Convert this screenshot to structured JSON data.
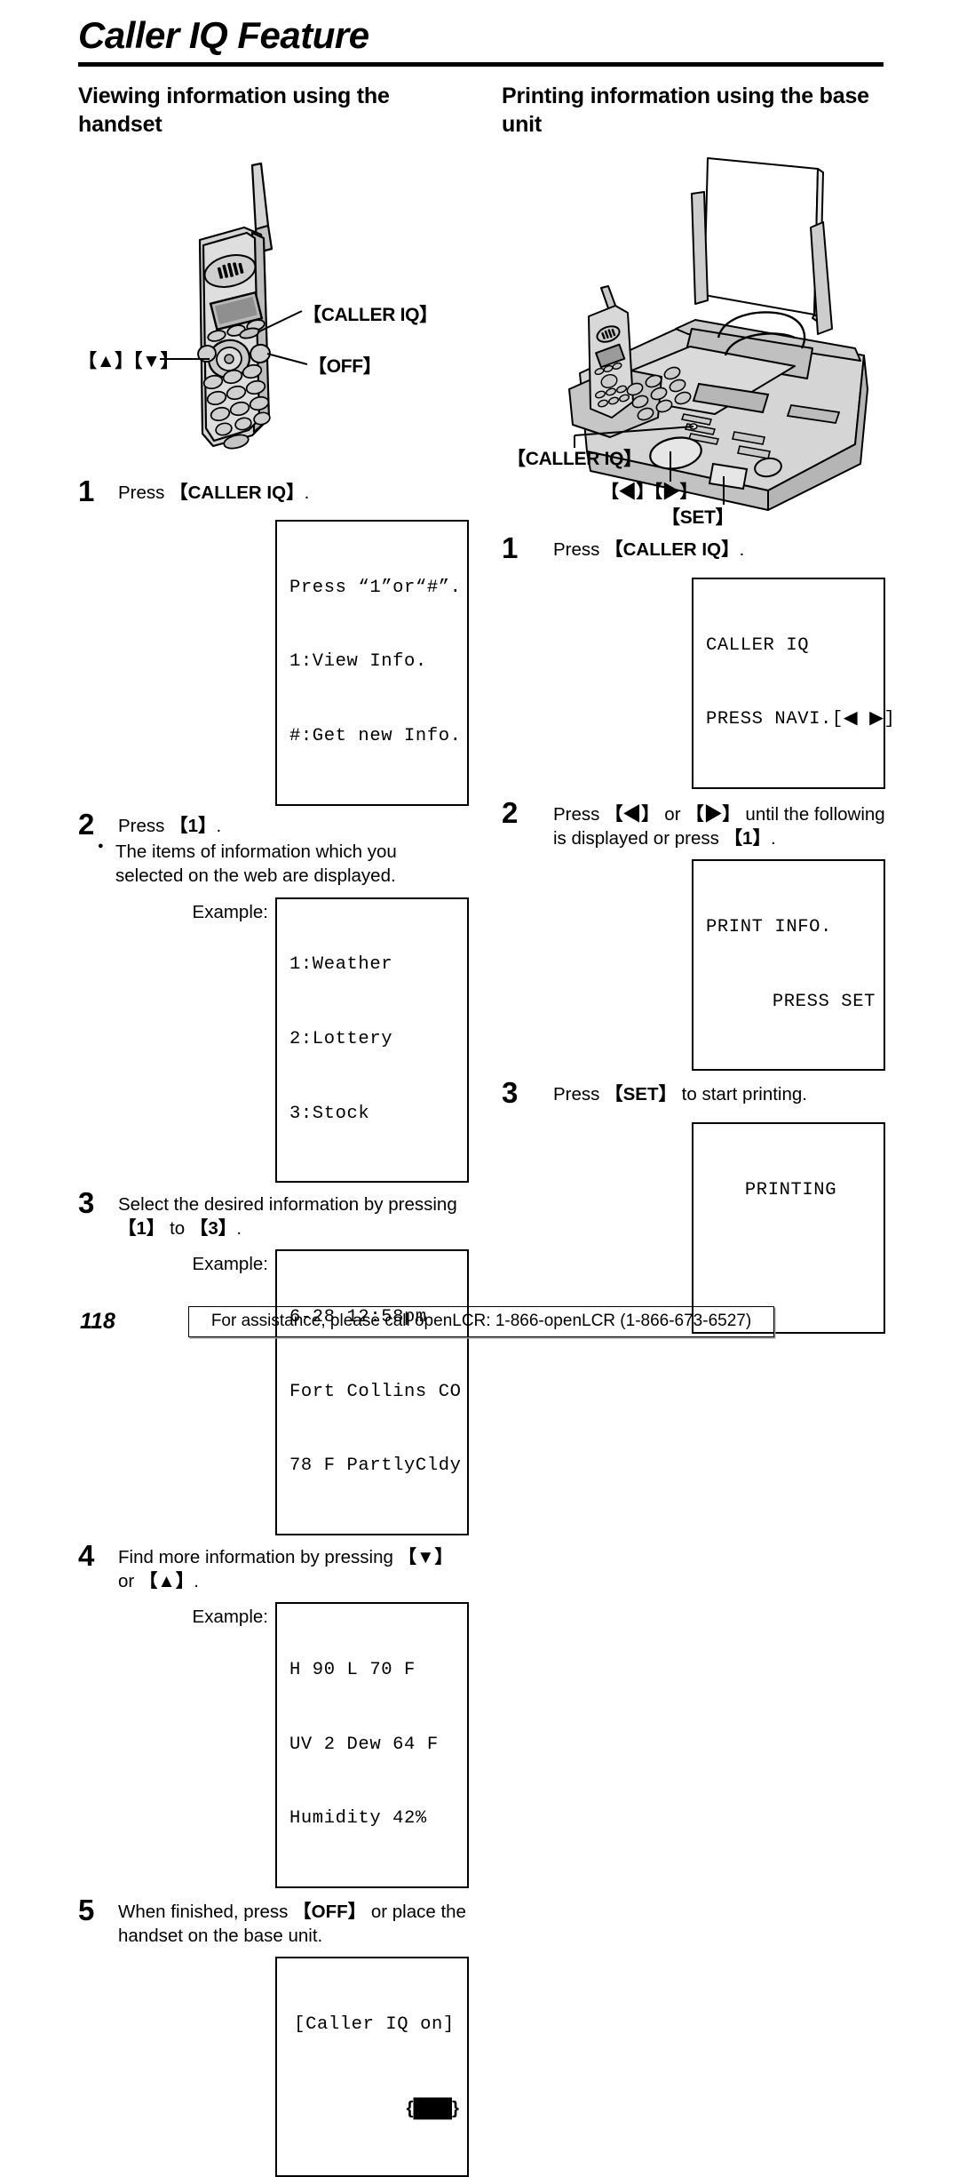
{
  "document": {
    "title": "Caller IQ Feature",
    "page_number": "118",
    "footer_note": "For assistance, please call openLCR: 1-866-openLCR (1-866-673-6527)"
  },
  "left_column": {
    "heading": "Viewing information using the handset",
    "illustration": {
      "name": "cordless-handset",
      "callouts": {
        "caller_iq": "【CALLER IQ】",
        "updown": "【▲】【▼】",
        "off": "【OFF】"
      }
    },
    "steps": [
      {
        "number": "1",
        "text_before": "Press ",
        "key": "【CALLER IQ】",
        "text_after": ".",
        "lcd_label": "",
        "lcd_lines": [
          "Press “1”or“#”.",
          "1:View Info.",
          "#:Get new Info."
        ]
      },
      {
        "number": "2",
        "text_before": "Press ",
        "key": "【1】",
        "text_after": ".",
        "bullet": "The items of information which you selected on the web are displayed.",
        "lcd_label": "Example:",
        "lcd_lines": [
          "1:Weather",
          "2:Lottery",
          "3:Stock"
        ]
      },
      {
        "number": "3",
        "text_before": "Select the desired information by pressing ",
        "key": "【1】",
        "text_mid": " to ",
        "key2": "【3】",
        "text_after": ".",
        "lcd_label": "Example:",
        "lcd_lines": [
          "6-28 12:58pm",
          "Fort Collins CO",
          "78 F PartlyCldy"
        ]
      },
      {
        "number": "4",
        "text_before": "Find more information by pressing ",
        "key": "【▼】",
        "text_mid": " or ",
        "key2": "【▲】",
        "text_after": ".",
        "lcd_label": "Example:",
        "lcd_lines": [
          "H 90 L 70 F",
          "UV 2 Dew 64 F",
          "Humidity 42%"
        ]
      },
      {
        "number": "5",
        "text_before": "When finished, press ",
        "key": "【OFF】",
        "text_after": " or place the handset on the base unit.",
        "lcd_label": "",
        "lcd_lines": [
          "[Caller IQ on]",
          "{███}"
        ]
      }
    ]
  },
  "right_column": {
    "heading": "Printing information using the base unit",
    "illustration": {
      "name": "fax-base-unit",
      "callouts": {
        "caller_iq": "【CALLER IQ】",
        "leftright": "【◀】【▶】",
        "set": "【SET】"
      }
    },
    "steps": [
      {
        "number": "1",
        "text_before": "Press ",
        "key": "【CALLER IQ】",
        "text_after": ".",
        "lcd_lines": [
          "CALLER IQ",
          "PRESS NAVI.[◀ ▶]"
        ]
      },
      {
        "number": "2",
        "text_before": "Press ",
        "key": "【◀】",
        "text_mid": " or ",
        "key2": "【▶】",
        "text_mid2": " until the following is displayed or press ",
        "key3": "【1】",
        "text_after": ".",
        "lcd_lines": [
          "PRINT INFO.",
          "PRESS SET"
        ]
      },
      {
        "number": "3",
        "text_before": "Press ",
        "key": "【SET】",
        "text_after": " to start printing.",
        "lcd_lines": [
          "PRINTING",
          ""
        ]
      }
    ]
  },
  "colors": {
    "ink": "#000000",
    "paper": "#ffffff",
    "art_fill": "#d5d5d5",
    "art_fill_dark": "#a8a8a8",
    "art_fill_light": "#ebebeb"
  }
}
